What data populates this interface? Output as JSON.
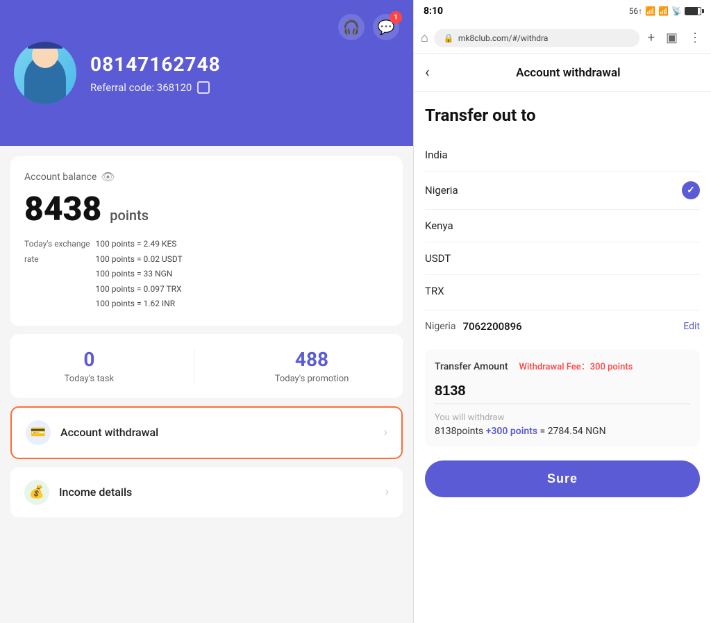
{
  "left": {
    "header": {
      "phone": "08147162748",
      "referral_label": "Referral code: 368120",
      "notification_count": "1"
    },
    "balance": {
      "label": "Account balance",
      "amount": "8438",
      "unit": "points"
    },
    "exchange": {
      "label": "Today's exchange\nrate",
      "rates": [
        "100 points = 2.49 KES",
        "100 points = 0.02 USDT",
        "100 points = 33 NGN",
        "100 points = 0.097 TRX",
        "100 points = 1.62 INR"
      ]
    },
    "stats": {
      "task_value": "0",
      "task_label": "Today's task",
      "promotion_value": "488",
      "promotion_label": "Today's promotion"
    },
    "menu": [
      {
        "id": "withdrawal",
        "label": "Account withdrawal",
        "highlighted": true
      },
      {
        "id": "income",
        "label": "Income details",
        "highlighted": false
      }
    ]
  },
  "right": {
    "status_bar": {
      "time": "8:10",
      "extra": "..."
    },
    "browser": {
      "url": "mk8club.com/#/withdra"
    },
    "page_title": "Account withdrawal",
    "transfer_title": "Transfer out to",
    "countries": [
      {
        "name": "India",
        "selected": false
      },
      {
        "name": "Nigeria",
        "selected": true
      },
      {
        "name": "Kenya",
        "selected": false
      },
      {
        "name": "USDT",
        "selected": false
      },
      {
        "name": "TRX",
        "selected": false
      }
    ],
    "account_info": {
      "country": "Nigeria",
      "number": "7062200896",
      "edit_label": "Edit"
    },
    "transfer_amount": {
      "label": "Transfer Amount",
      "fee_label": "Withdrawal Fee：300 points",
      "amount_value": "8138"
    },
    "withdraw_summary": {
      "label": "You will withdraw",
      "value_main": "8138points",
      "value_bonus": "+300 points",
      "value_equals": "= 2784.54 NGN"
    },
    "sure_button": "Sure"
  }
}
